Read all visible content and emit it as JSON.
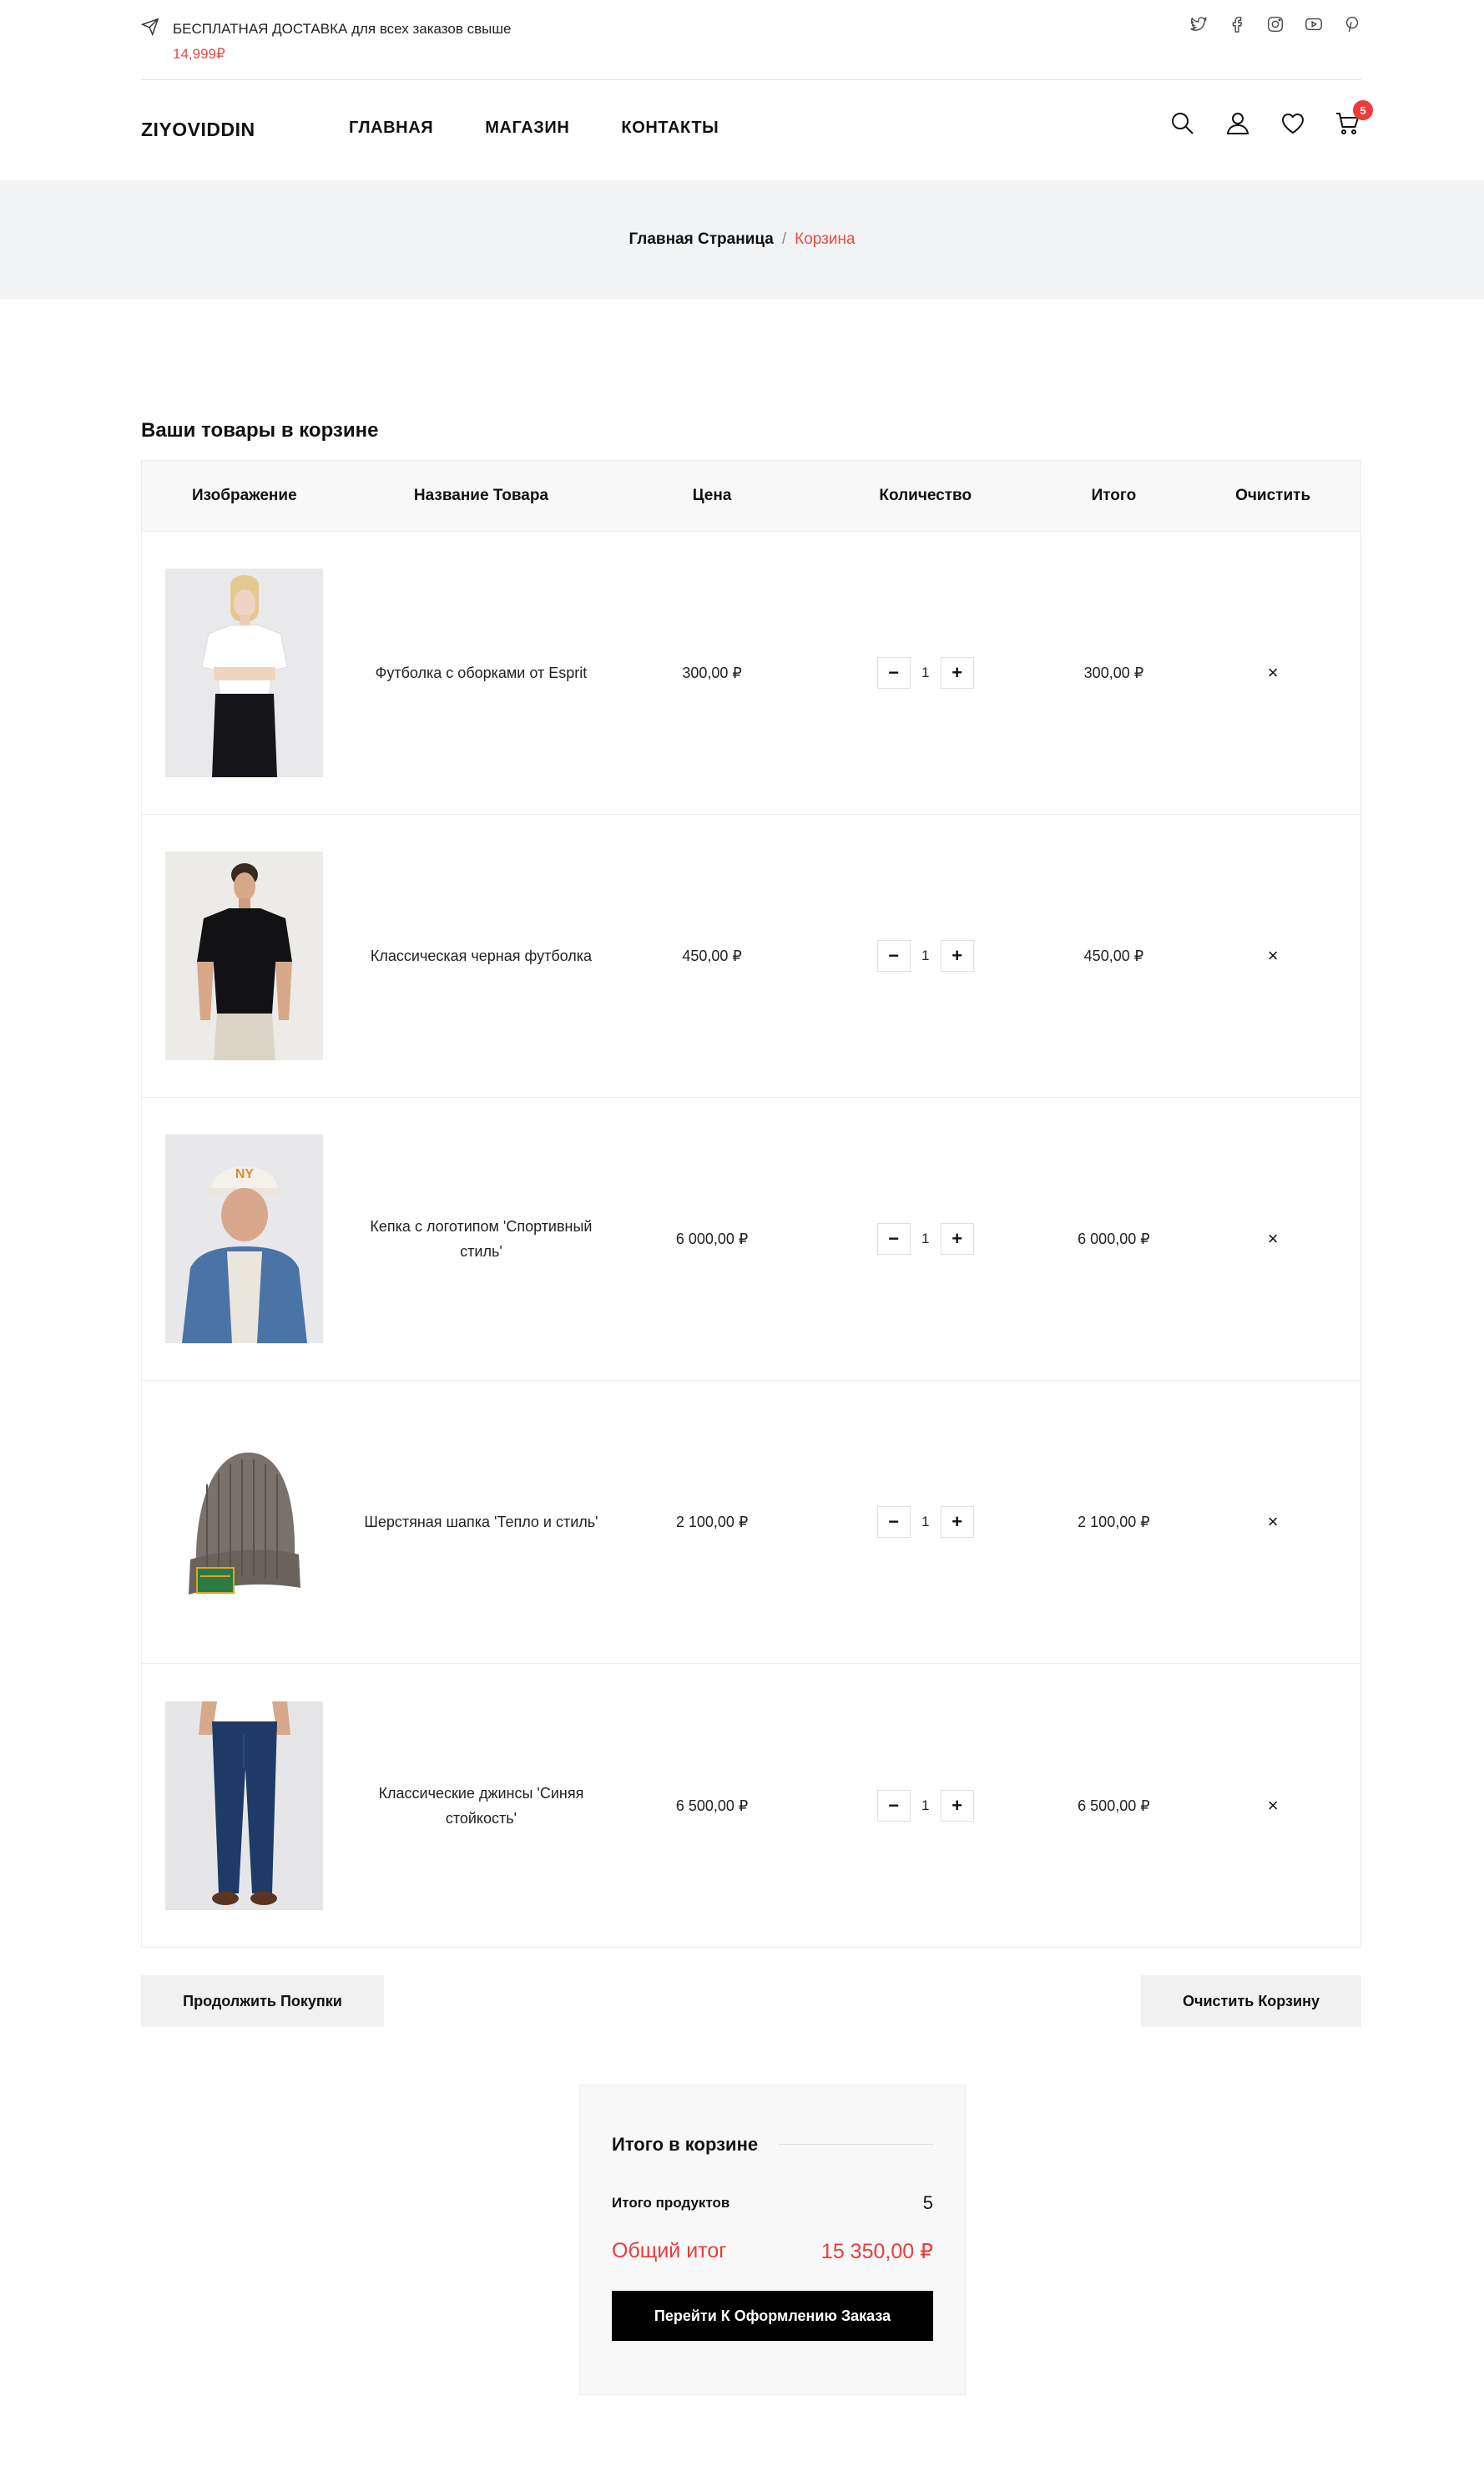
{
  "topbar": {
    "promo_text": "БЕСПЛАТНАЯ ДОСТАВКА для всех заказов свыше",
    "promo_price": "14,999₽",
    "socials": [
      "twitter-icon",
      "facebook-icon",
      "instagram-icon",
      "youtube-icon",
      "pinterest-icon"
    ]
  },
  "header": {
    "logo": "ZIYOVIDDIN",
    "nav": [
      "ГЛАВНАЯ",
      "МАГАЗИН",
      "КОНТАКТЫ"
    ],
    "cart_count": "5"
  },
  "breadcrumb": {
    "home": "Главная Страница",
    "separator": "/",
    "current": "Корзина"
  },
  "cart": {
    "title": "Ваши товары в корзине",
    "columns": [
      "Изображение",
      "Название Товара",
      "Цена",
      "Количество",
      "Итого",
      "Очистить"
    ],
    "items": [
      {
        "name": "Футболка с оборками от Esprit",
        "price": "300,00 ₽",
        "qty": "1",
        "total": "300,00 ₽",
        "remove": "×"
      },
      {
        "name": "Классическая черная футболка",
        "price": "450,00 ₽",
        "qty": "1",
        "total": "450,00 ₽",
        "remove": "×"
      },
      {
        "name": "Кепка с логотипом 'Спортивный стиль'",
        "price": "6 000,00 ₽",
        "qty": "1",
        "total": "6 000,00 ₽",
        "remove": "×"
      },
      {
        "name": "Шерстяная шапка 'Тепло и стиль'",
        "price": "2 100,00 ₽",
        "qty": "1",
        "total": "2 100,00 ₽",
        "remove": "×"
      },
      {
        "name": "Классические джинсы 'Синяя стойкость'",
        "price": "6 500,00 ₽",
        "qty": "1",
        "total": "6 500,00 ₽",
        "remove": "×"
      }
    ],
    "minus": "−",
    "plus": "+"
  },
  "actions": {
    "continue": "Продолжить Покупки",
    "clear": "Очистить Корзину"
  },
  "totals": {
    "title": "Итого в корзине",
    "products_label": "Итого продуктов",
    "products_value": "5",
    "grand_label": "Общий итог",
    "grand_value": "15 350,00 ₽",
    "checkout": "Перейти К Оформлению Заказа"
  },
  "colors": {
    "accent": "#ec4846",
    "band": "#f1f3f5"
  }
}
